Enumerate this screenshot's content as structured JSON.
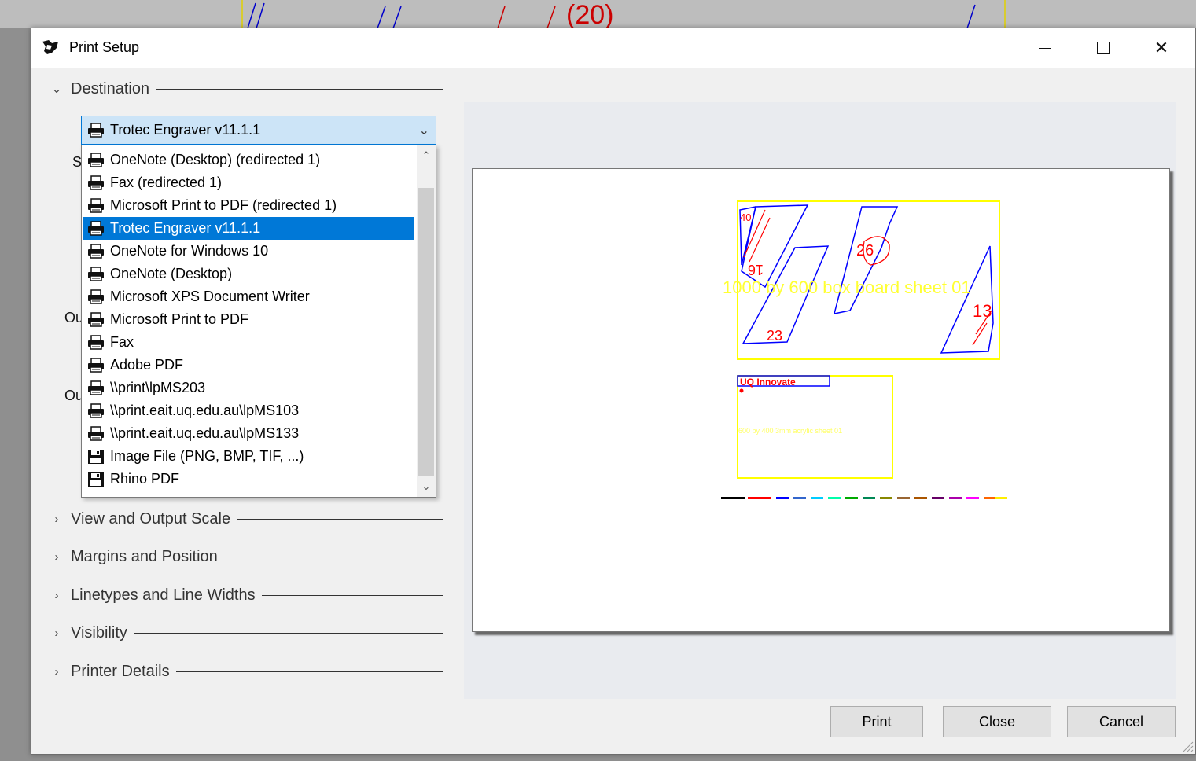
{
  "window": {
    "title": "Print Setup",
    "minimize_icon": "minimize-icon",
    "maximize_icon": "maximize-icon",
    "close_symbol": "✕"
  },
  "sections": {
    "destination": "Destination",
    "view_scale": "View and Output Scale",
    "margins": "Margins and Position",
    "linetypes": "Linetypes and Line Widths",
    "visibility": "Visibility",
    "printer_details": "Printer Details"
  },
  "hidden_labels": {
    "s_label": "S",
    "ou_label_1": "Ou",
    "ou_label_2": "Ou"
  },
  "printer_combo": {
    "selected": "Trotec Engraver v11.1.1",
    "arrow": "⌄"
  },
  "printer_list": [
    {
      "label": "OneNote (Desktop) (redirected 1)",
      "icon": "printer-icon",
      "selected": false
    },
    {
      "label": "Fax (redirected 1)",
      "icon": "printer-icon",
      "selected": false
    },
    {
      "label": "Microsoft Print to PDF (redirected 1)",
      "icon": "printer-icon",
      "selected": false
    },
    {
      "label": "Trotec Engraver v11.1.1",
      "icon": "printer-icon",
      "selected": true
    },
    {
      "label": "OneNote for Windows 10",
      "icon": "printer-icon",
      "selected": false
    },
    {
      "label": "OneNote (Desktop)",
      "icon": "printer-icon",
      "selected": false
    },
    {
      "label": "Microsoft XPS Document Writer",
      "icon": "printer-icon",
      "selected": false
    },
    {
      "label": "Microsoft Print to PDF",
      "icon": "printer-icon",
      "selected": false
    },
    {
      "label": "Fax",
      "icon": "printer-icon",
      "selected": false
    },
    {
      "label": "Adobe PDF",
      "icon": "printer-icon",
      "selected": false
    },
    {
      "label": "\\\\print\\lpMS203",
      "icon": "printer-icon",
      "selected": false
    },
    {
      "label": "\\\\print.eait.uq.edu.au\\lpMS103",
      "icon": "printer-icon",
      "selected": false
    },
    {
      "label": "\\\\print.eait.uq.edu.au\\lpMS133",
      "icon": "printer-icon",
      "selected": false
    },
    {
      "label": "Image File (PNG, BMP, TIF, ...)",
      "icon": "floppy-icon",
      "selected": false
    },
    {
      "label": "Rhino PDF",
      "icon": "floppy-icon",
      "selected": false
    }
  ],
  "preview": {
    "sheet1_label": "1000 by 600 box board sheet 01",
    "sheet2_label": "600 by 400 3mm acrylic sheet 01",
    "part_numbers": [
      "40",
      "16",
      "26",
      "23",
      "13"
    ],
    "logo_text": "UQ Innovate",
    "colors": {
      "outline": "#0000ff",
      "cut": "#ff0000",
      "sheet_border": "#ffff00"
    }
  },
  "buttons": {
    "print": "Print",
    "close": "Close",
    "cancel": "Cancel"
  },
  "colors": {
    "accent": "#0078d7",
    "combo_bg": "#cce4f7"
  }
}
